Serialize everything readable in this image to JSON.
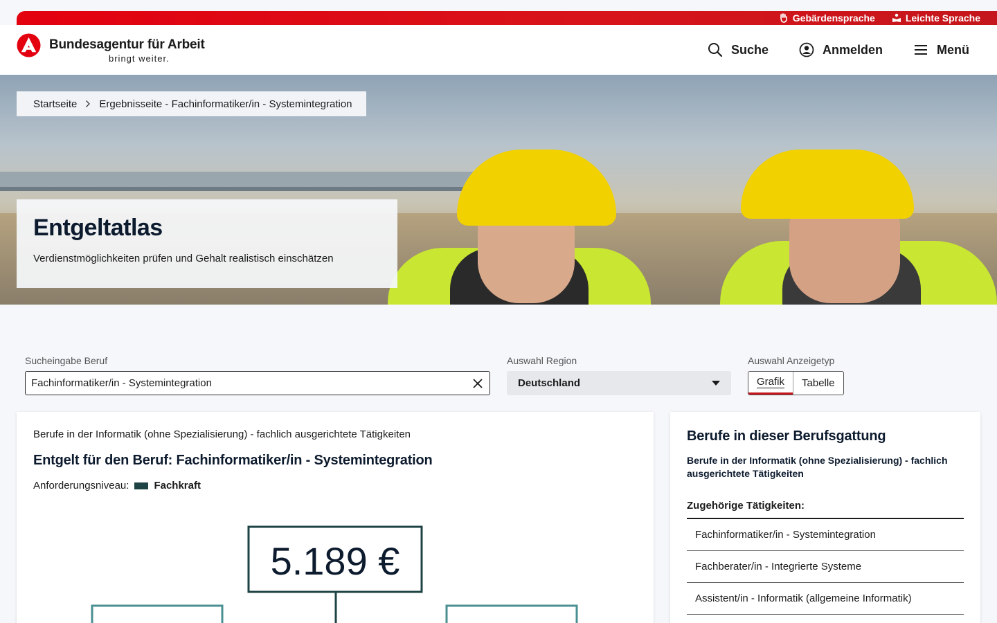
{
  "topbar": {
    "sign_language": "Gebärdensprache",
    "easy_language": "Leichte Sprache"
  },
  "header": {
    "logo_title": "Bundesagentur für Arbeit",
    "logo_sub": "bringt weiter.",
    "search_label": "Suche",
    "login_label": "Anmelden",
    "menu_label": "Menü"
  },
  "breadcrumb": {
    "home": "Startseite",
    "current": "Ergebnisseite - Fachinformatiker/in - Systemintegration"
  },
  "hero": {
    "title": "Entgeltatlas",
    "subtitle": "Verdienstmöglichkeiten prüfen und Gehalt realistisch einschätzen"
  },
  "filters": {
    "search_label": "Sucheingabe Beruf",
    "search_value": "Fachinformatiker/in - Systemintegration",
    "region_label": "Auswahl Region",
    "region_value": "Deutschland",
    "display_label": "Auswahl Anzeigetyp",
    "display_options": [
      "Grafik",
      "Tabelle"
    ],
    "display_selected": "Grafik"
  },
  "main": {
    "occupation_group": "Berufe in der Informatik (ohne Spezialisierung) - fachlich ausgerichtete Tätigkeiten",
    "title": "Entgelt für den Beruf: Fachinformatiker/in - Systemintegration",
    "level_label": "Anforderungsniveau:",
    "level_value": "Fachkraft",
    "level_color": "#1d4344",
    "median": "5.189 €"
  },
  "side": {
    "title": "Berufe in dieser Berufsgattung",
    "group": "Berufe in der Informatik (ohne Spezialisierung) - fachlich ausgerichtete Tätigkeiten",
    "subheading": "Zugehörige Tätigkeiten:",
    "items": [
      "Fachinformatiker/in - Systemintegration",
      "Fachberater/in - Integrierte Systeme",
      "Assistent/in - Informatik (allgemeine Informatik)"
    ]
  },
  "colors": {
    "brand_red": "#e3000f",
    "dark_teal": "#1d4344",
    "light_teal": "#4a8f91"
  }
}
